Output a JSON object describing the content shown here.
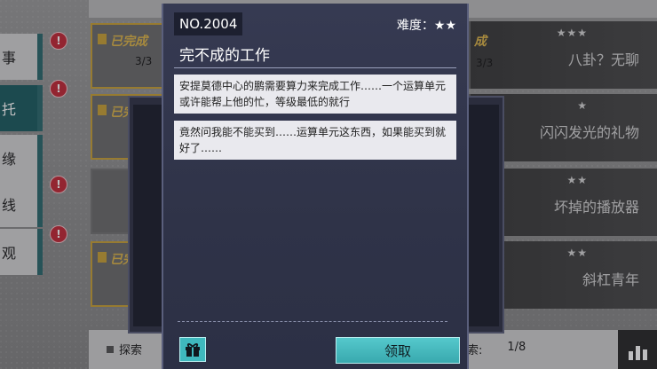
{
  "mission": {
    "number": "NO.2004",
    "difficulty_label": "难度：★★",
    "title": "完不成的工作",
    "messages": [
      "安提莫德中心的鹏需要算力来完成工作……一个运算单元或许能帮上他的忙，等级最低的就行",
      "竟然问我能不能买到……运算单元这东西，如果能买到就好了……"
    ],
    "claim_label": "领取",
    "gift_icon": "gift-icon"
  },
  "left_tabs": [
    {
      "label": "事",
      "alert": "!"
    },
    {
      "label": "托",
      "alert": "!"
    },
    {
      "label": "缘",
      "alert": ""
    },
    {
      "label": "线",
      "alert": "!"
    },
    {
      "label": "观",
      "alert": "!"
    }
  ],
  "left_cards": [
    {
      "status": "已完成",
      "progress": "3/3"
    },
    {
      "status": "已完成",
      "progress": ""
    },
    {
      "status": "",
      "progress": ""
    },
    {
      "status": "已完",
      "progress": ""
    }
  ],
  "right_cards": [
    {
      "stars": "★★★",
      "title": "八卦？无聊",
      "fragment": "成",
      "progress": "3/3"
    },
    {
      "stars": "★",
      "title": "闪闪发光的礼物"
    },
    {
      "stars": "★★",
      "title": "坏掉的播放器"
    },
    {
      "stars": "★★",
      "title": "斜杠青年"
    }
  ],
  "bottom_bar": {
    "explore_label": "探索",
    "unexplored_label": "未探索:",
    "unexplored_value": "1/8",
    "chart_icon": "bar-chart-icon"
  },
  "colors": {
    "dialog_bg": "#363a52",
    "claim_button": "#46bcc1",
    "alert_badge": "#c42c3a",
    "active_tab": "#1f5f63"
  }
}
